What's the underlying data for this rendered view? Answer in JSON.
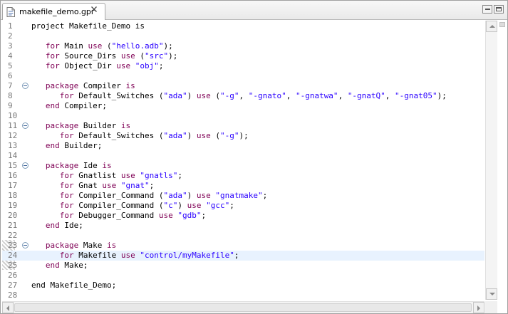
{
  "tab": {
    "title": "makefile_demo.gpr",
    "icon": "gpr-file-icon",
    "close_icon": "close-icon"
  },
  "window_controls": {
    "minimize_icon": "minimize-icon",
    "maximize_icon": "maximize-icon"
  },
  "editor": {
    "current_line": 24,
    "folding": [
      7,
      11,
      15,
      23
    ],
    "lines": [
      {
        "n": "1",
        "t": [
          {
            "k": "p",
            "s": "project Makefile_Demo is"
          }
        ]
      },
      {
        "n": "2",
        "t": []
      },
      {
        "n": "3",
        "t": [
          {
            "k": "p",
            "s": "   "
          },
          {
            "k": "kw",
            "s": "for"
          },
          {
            "k": "p",
            "s": " Main "
          },
          {
            "k": "kw",
            "s": "use"
          },
          {
            "k": "p",
            "s": " ("
          },
          {
            "k": "str",
            "s": "\"hello.adb\""
          },
          {
            "k": "p",
            "s": ");"
          }
        ]
      },
      {
        "n": "4",
        "t": [
          {
            "k": "p",
            "s": "   "
          },
          {
            "k": "kw",
            "s": "for"
          },
          {
            "k": "p",
            "s": " Source_Dirs "
          },
          {
            "k": "kw",
            "s": "use"
          },
          {
            "k": "p",
            "s": " ("
          },
          {
            "k": "str",
            "s": "\"src\""
          },
          {
            "k": "p",
            "s": ");"
          }
        ]
      },
      {
        "n": "5",
        "t": [
          {
            "k": "p",
            "s": "   "
          },
          {
            "k": "kw",
            "s": "for"
          },
          {
            "k": "p",
            "s": " Object_Dir "
          },
          {
            "k": "kw",
            "s": "use"
          },
          {
            "k": "p",
            "s": " "
          },
          {
            "k": "str",
            "s": "\"obj\""
          },
          {
            "k": "p",
            "s": ";"
          }
        ]
      },
      {
        "n": "6",
        "t": []
      },
      {
        "n": "7",
        "t": [
          {
            "k": "p",
            "s": "   "
          },
          {
            "k": "kw",
            "s": "package"
          },
          {
            "k": "p",
            "s": " Compiler "
          },
          {
            "k": "kw",
            "s": "is"
          }
        ]
      },
      {
        "n": "8",
        "t": [
          {
            "k": "p",
            "s": "      "
          },
          {
            "k": "kw",
            "s": "for"
          },
          {
            "k": "p",
            "s": " Default_Switches ("
          },
          {
            "k": "str",
            "s": "\"ada\""
          },
          {
            "k": "p",
            "s": ") "
          },
          {
            "k": "kw",
            "s": "use"
          },
          {
            "k": "p",
            "s": " ("
          },
          {
            "k": "str",
            "s": "\"-g\""
          },
          {
            "k": "p",
            "s": ", "
          },
          {
            "k": "str",
            "s": "\"-gnato\""
          },
          {
            "k": "p",
            "s": ", "
          },
          {
            "k": "str",
            "s": "\"-gnatwa\""
          },
          {
            "k": "p",
            "s": ", "
          },
          {
            "k": "str",
            "s": "\"-gnatQ\""
          },
          {
            "k": "p",
            "s": ", "
          },
          {
            "k": "str",
            "s": "\"-gnat05\""
          },
          {
            "k": "p",
            "s": ");"
          }
        ]
      },
      {
        "n": "9",
        "t": [
          {
            "k": "p",
            "s": "   "
          },
          {
            "k": "kw",
            "s": "end"
          },
          {
            "k": "p",
            "s": " Compiler;"
          }
        ]
      },
      {
        "n": "10",
        "t": []
      },
      {
        "n": "11",
        "t": [
          {
            "k": "p",
            "s": "   "
          },
          {
            "k": "kw",
            "s": "package"
          },
          {
            "k": "p",
            "s": " Builder "
          },
          {
            "k": "kw",
            "s": "is"
          }
        ]
      },
      {
        "n": "12",
        "t": [
          {
            "k": "p",
            "s": "      "
          },
          {
            "k": "kw",
            "s": "for"
          },
          {
            "k": "p",
            "s": " Default_Switches ("
          },
          {
            "k": "str",
            "s": "\"ada\""
          },
          {
            "k": "p",
            "s": ") "
          },
          {
            "k": "kw",
            "s": "use"
          },
          {
            "k": "p",
            "s": " ("
          },
          {
            "k": "str",
            "s": "\"-g\""
          },
          {
            "k": "p",
            "s": ");"
          }
        ]
      },
      {
        "n": "13",
        "t": [
          {
            "k": "p",
            "s": "   "
          },
          {
            "k": "kw",
            "s": "end"
          },
          {
            "k": "p",
            "s": " Builder;"
          }
        ]
      },
      {
        "n": "14",
        "t": []
      },
      {
        "n": "15",
        "t": [
          {
            "k": "p",
            "s": "   "
          },
          {
            "k": "kw",
            "s": "package"
          },
          {
            "k": "p",
            "s": " Ide "
          },
          {
            "k": "kw",
            "s": "is"
          }
        ]
      },
      {
        "n": "16",
        "t": [
          {
            "k": "p",
            "s": "      "
          },
          {
            "k": "kw",
            "s": "for"
          },
          {
            "k": "p",
            "s": " Gnatlist "
          },
          {
            "k": "kw",
            "s": "use"
          },
          {
            "k": "p",
            "s": " "
          },
          {
            "k": "str",
            "s": "\"gnatls\""
          },
          {
            "k": "p",
            "s": ";"
          }
        ]
      },
      {
        "n": "17",
        "t": [
          {
            "k": "p",
            "s": "      "
          },
          {
            "k": "kw",
            "s": "for"
          },
          {
            "k": "p",
            "s": " Gnat "
          },
          {
            "k": "kw",
            "s": "use"
          },
          {
            "k": "p",
            "s": " "
          },
          {
            "k": "str",
            "s": "\"gnat\""
          },
          {
            "k": "p",
            "s": ";"
          }
        ]
      },
      {
        "n": "18",
        "t": [
          {
            "k": "p",
            "s": "      "
          },
          {
            "k": "kw",
            "s": "for"
          },
          {
            "k": "p",
            "s": " Compiler_Command ("
          },
          {
            "k": "str",
            "s": "\"ada\""
          },
          {
            "k": "p",
            "s": ") "
          },
          {
            "k": "kw",
            "s": "use"
          },
          {
            "k": "p",
            "s": " "
          },
          {
            "k": "str",
            "s": "\"gnatmake\""
          },
          {
            "k": "p",
            "s": ";"
          }
        ]
      },
      {
        "n": "19",
        "t": [
          {
            "k": "p",
            "s": "      "
          },
          {
            "k": "kw",
            "s": "for"
          },
          {
            "k": "p",
            "s": " Compiler_Command ("
          },
          {
            "k": "str",
            "s": "\"c\""
          },
          {
            "k": "p",
            "s": ") "
          },
          {
            "k": "kw",
            "s": "use"
          },
          {
            "k": "p",
            "s": " "
          },
          {
            "k": "str",
            "s": "\"gcc\""
          },
          {
            "k": "p",
            "s": ";"
          }
        ]
      },
      {
        "n": "20",
        "t": [
          {
            "k": "p",
            "s": "      "
          },
          {
            "k": "kw",
            "s": "for"
          },
          {
            "k": "p",
            "s": " Debugger_Command "
          },
          {
            "k": "kw",
            "s": "use"
          },
          {
            "k": "p",
            "s": " "
          },
          {
            "k": "str",
            "s": "\"gdb\""
          },
          {
            "k": "p",
            "s": ";"
          }
        ]
      },
      {
        "n": "21",
        "t": [
          {
            "k": "p",
            "s": "   "
          },
          {
            "k": "kw",
            "s": "end"
          },
          {
            "k": "p",
            "s": " Ide;"
          }
        ]
      },
      {
        "n": "22",
        "t": []
      },
      {
        "n": "23",
        "t": [
          {
            "k": "p",
            "s": "   "
          },
          {
            "k": "kw",
            "s": "package"
          },
          {
            "k": "p",
            "s": " Make "
          },
          {
            "k": "kw",
            "s": "is"
          }
        ]
      },
      {
        "n": "24",
        "t": [
          {
            "k": "p",
            "s": "      "
          },
          {
            "k": "kw",
            "s": "for"
          },
          {
            "k": "p",
            "s": " Makefile "
          },
          {
            "k": "kw",
            "s": "use"
          },
          {
            "k": "p",
            "s": " "
          },
          {
            "k": "str",
            "s": "\"control/myMakefile\""
          },
          {
            "k": "p",
            "s": ";"
          }
        ]
      },
      {
        "n": "25",
        "t": [
          {
            "k": "p",
            "s": "   "
          },
          {
            "k": "kw",
            "s": "end"
          },
          {
            "k": "p",
            "s": " Make;"
          }
        ]
      },
      {
        "n": "26",
        "t": []
      },
      {
        "n": "27",
        "t": [
          {
            "k": "p",
            "s": "end Makefile_Demo;"
          }
        ]
      },
      {
        "n": "28",
        "t": []
      }
    ]
  },
  "scrollbars": {
    "up_icon": "scroll-up-icon",
    "down_icon": "scroll-down-icon",
    "left_icon": "scroll-left-icon",
    "right_icon": "scroll-right-icon"
  }
}
